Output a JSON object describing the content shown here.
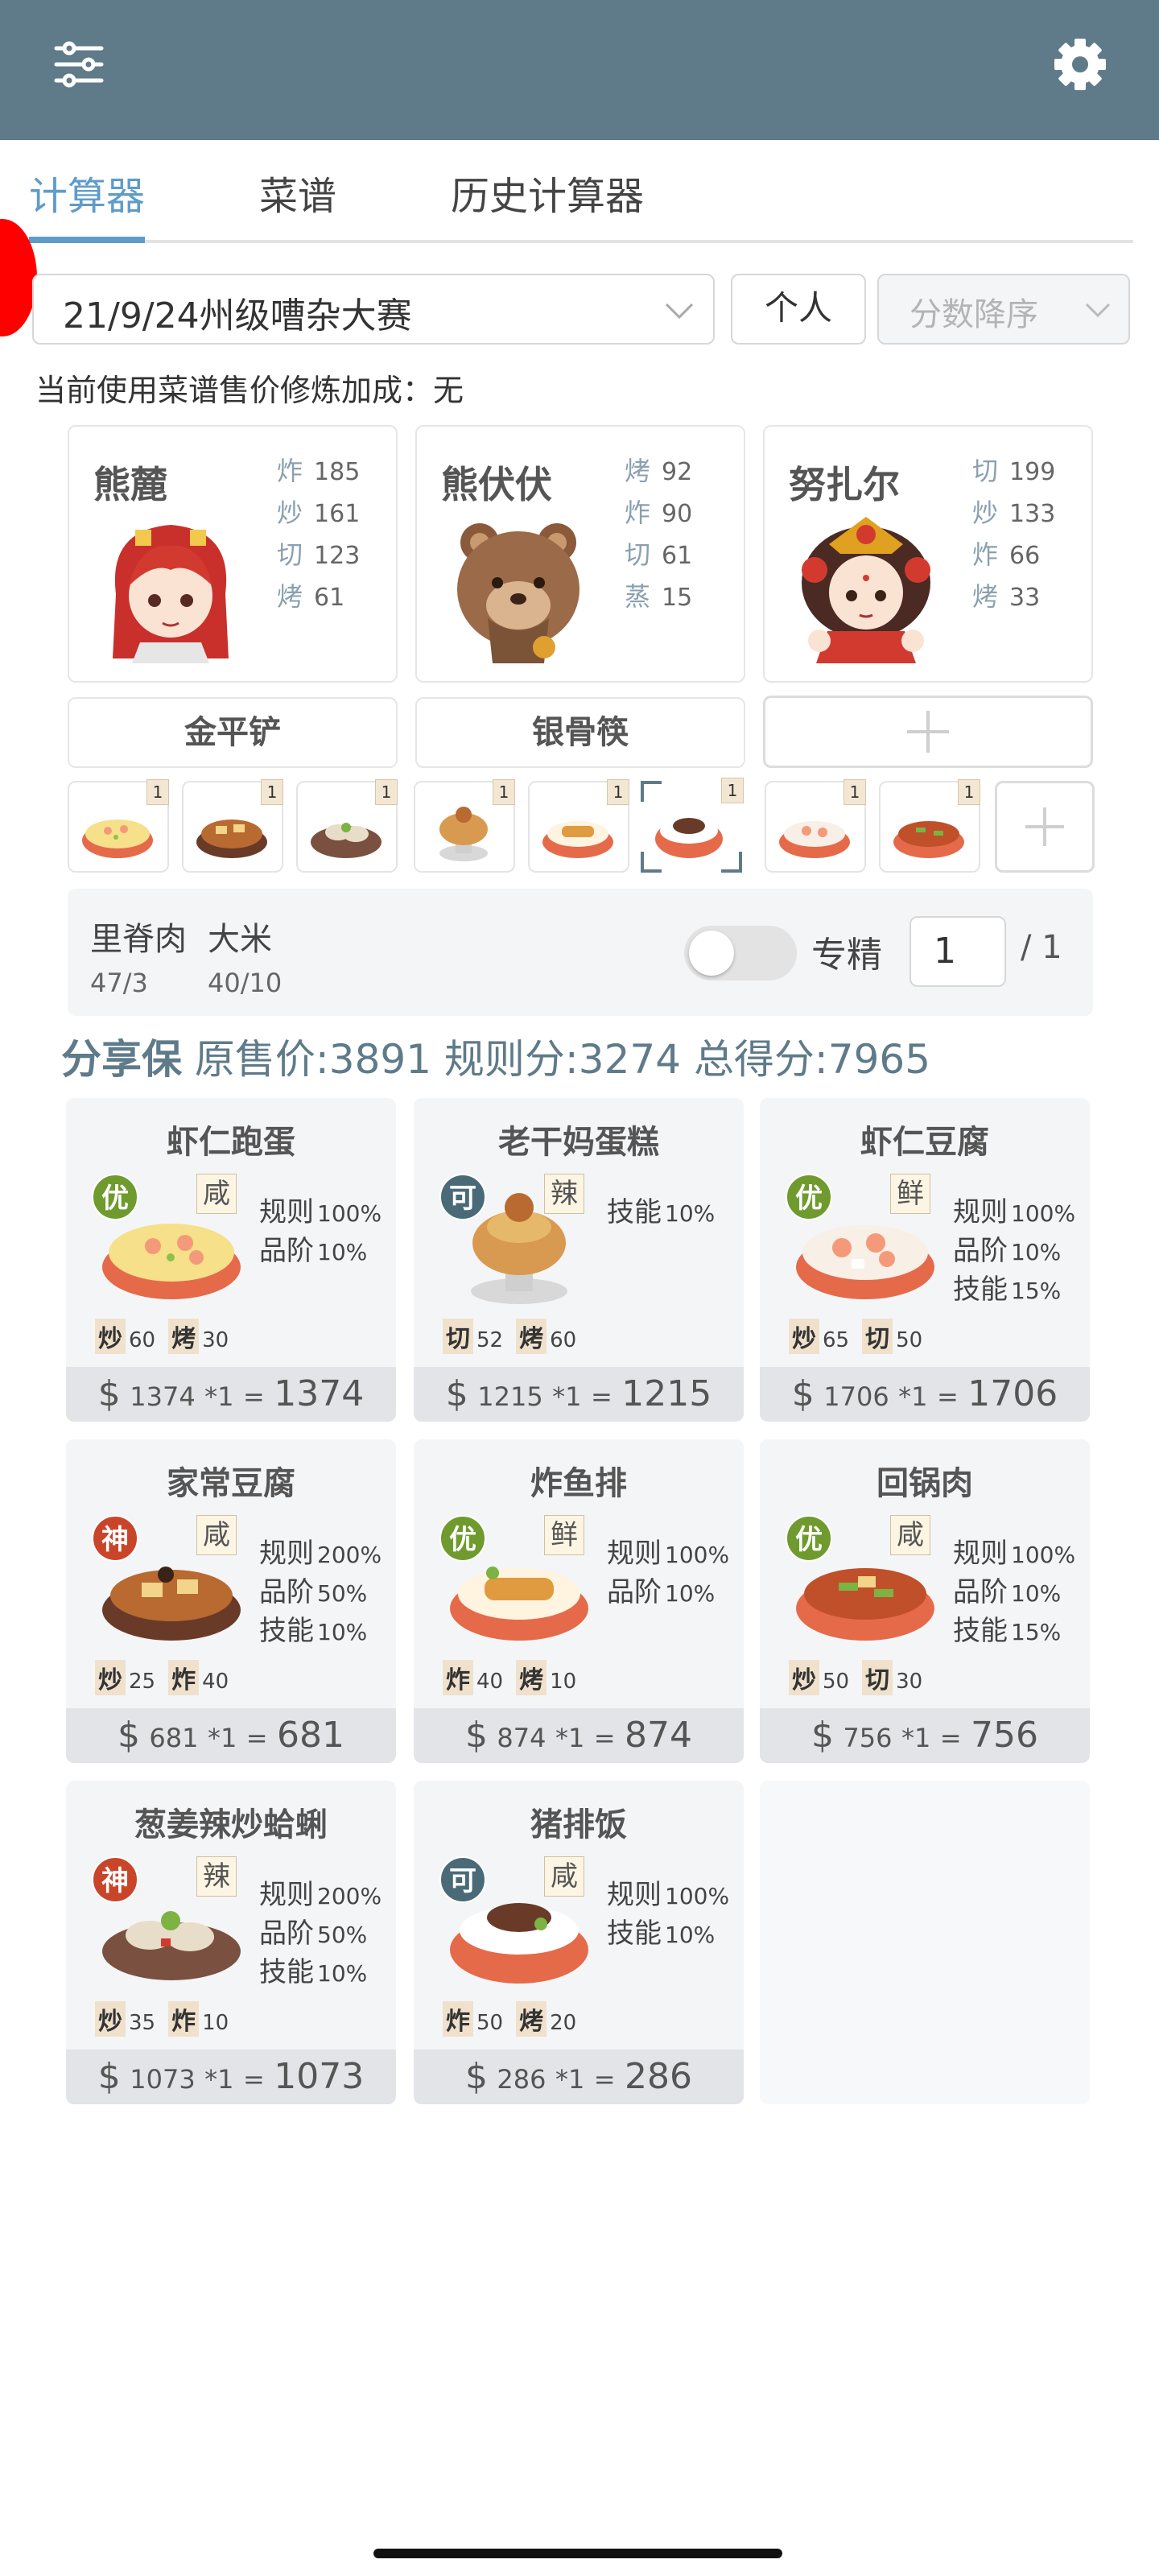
{
  "tabs": [
    "计算器",
    "菜谱",
    "历史计算器"
  ],
  "contest_select": "21/9/24州级嘈杂大赛",
  "mode_button": "个人",
  "sort_select": "分数降序",
  "bonus_note": "当前使用菜谱售价修炼加成：无",
  "chefs": [
    {
      "name": "熊麓",
      "skills": [
        {
          "k": "炸",
          "v": "185"
        },
        {
          "k": "炒",
          "v": "161"
        },
        {
          "k": "切",
          "v": "123"
        },
        {
          "k": "烤",
          "v": "61"
        }
      ]
    },
    {
      "name": "熊伏伏",
      "skills": [
        {
          "k": "烤",
          "v": "92"
        },
        {
          "k": "炸",
          "v": "90"
        },
        {
          "k": "切",
          "v": "61"
        },
        {
          "k": "蒸",
          "v": "15"
        }
      ]
    },
    {
      "name": "努扎尔",
      "skills": [
        {
          "k": "切",
          "v": "199"
        },
        {
          "k": "炒",
          "v": "133"
        },
        {
          "k": "炸",
          "v": "66"
        },
        {
          "k": "烤",
          "v": "33"
        }
      ]
    }
  ],
  "equipment": [
    "金平铲",
    "银骨筷"
  ],
  "dish_slots": [
    {
      "qty": "1",
      "selected": false
    },
    {
      "qty": "1",
      "selected": false
    },
    {
      "qty": "1",
      "selected": false
    },
    {
      "qty": "1",
      "selected": false
    },
    {
      "qty": "1",
      "selected": false
    },
    {
      "qty": "1",
      "selected": true
    },
    {
      "qty": "1",
      "selected": false
    },
    {
      "qty": "1",
      "selected": false
    }
  ],
  "ingredients": [
    {
      "name": "里脊肉",
      "count": "47/3"
    },
    {
      "name": "大米",
      "count": "40/10"
    }
  ],
  "specialty_label": "专精",
  "specialty_value": "1",
  "specialty_max": "/ 1",
  "summary": {
    "share_label": "分享保",
    "original_label": "原售价:",
    "original_value": "3891",
    "rule_label": "规则分:",
    "rule_value": "3274",
    "total_label": "总得分:",
    "total_value": "7965"
  },
  "recipes": [
    {
      "name": "虾仁跑蛋",
      "rank": "优",
      "rank_color": "#6f9a2e",
      "flavor": "咸",
      "bonus": [
        {
          "label": "规则",
          "pct": "100%"
        },
        {
          "label": "品阶",
          "pct": "10%"
        }
      ],
      "reqs": [
        {
          "k": "炒",
          "v": "60"
        },
        {
          "k": "烤",
          "v": "30"
        }
      ],
      "price": "1374",
      "mult": "*1",
      "total": "1374"
    },
    {
      "name": "老干妈蛋糕",
      "rank": "可",
      "rank_color": "#4a6a78",
      "flavor": "辣",
      "bonus": [
        {
          "label": "技能",
          "pct": "10%"
        }
      ],
      "reqs": [
        {
          "k": "切",
          "v": "52"
        },
        {
          "k": "烤",
          "v": "60"
        }
      ],
      "price": "1215",
      "mult": "*1",
      "total": "1215"
    },
    {
      "name": "虾仁豆腐",
      "rank": "优",
      "rank_color": "#6f9a2e",
      "flavor": "鲜",
      "bonus": [
        {
          "label": "规则",
          "pct": "100%"
        },
        {
          "label": "品阶",
          "pct": "10%"
        },
        {
          "label": "技能",
          "pct": "15%"
        }
      ],
      "reqs": [
        {
          "k": "炒",
          "v": "65"
        },
        {
          "k": "切",
          "v": "50"
        }
      ],
      "price": "1706",
      "mult": "*1",
      "total": "1706"
    },
    {
      "name": "家常豆腐",
      "rank": "神",
      "rank_color": "#c9452a",
      "flavor": "咸",
      "bonus": [
        {
          "label": "规则",
          "pct": "200%"
        },
        {
          "label": "品阶",
          "pct": "50%"
        },
        {
          "label": "技能",
          "pct": "10%"
        }
      ],
      "reqs": [
        {
          "k": "炒",
          "v": "25"
        },
        {
          "k": "炸",
          "v": "40"
        }
      ],
      "price": "681",
      "mult": "*1",
      "total": "681"
    },
    {
      "name": "炸鱼排",
      "rank": "优",
      "rank_color": "#6f9a2e",
      "flavor": "鲜",
      "bonus": [
        {
          "label": "规则",
          "pct": "100%"
        },
        {
          "label": "品阶",
          "pct": "10%"
        }
      ],
      "reqs": [
        {
          "k": "炸",
          "v": "40"
        },
        {
          "k": "烤",
          "v": "10"
        }
      ],
      "price": "874",
      "mult": "*1",
      "total": "874"
    },
    {
      "name": "回锅肉",
      "rank": "优",
      "rank_color": "#6f9a2e",
      "flavor": "咸",
      "bonus": [
        {
          "label": "规则",
          "pct": "100%"
        },
        {
          "label": "品阶",
          "pct": "10%"
        },
        {
          "label": "技能",
          "pct": "15%"
        }
      ],
      "reqs": [
        {
          "k": "炒",
          "v": "50"
        },
        {
          "k": "切",
          "v": "30"
        }
      ],
      "price": "756",
      "mult": "*1",
      "total": "756"
    },
    {
      "name": "葱姜辣炒蛤蜊",
      "rank": "神",
      "rank_color": "#c9452a",
      "flavor": "辣",
      "bonus": [
        {
          "label": "规则",
          "pct": "200%"
        },
        {
          "label": "品阶",
          "pct": "50%"
        },
        {
          "label": "技能",
          "pct": "10%"
        }
      ],
      "reqs": [
        {
          "k": "炒",
          "v": "35"
        },
        {
          "k": "炸",
          "v": "10"
        }
      ],
      "price": "1073",
      "mult": "*1",
      "total": "1073"
    },
    {
      "name": "猪排饭",
      "rank": "可",
      "rank_color": "#4a6a78",
      "flavor": "咸",
      "bonus": [
        {
          "label": "规则",
          "pct": "100%"
        },
        {
          "label": "技能",
          "pct": "10%"
        }
      ],
      "reqs": [
        {
          "k": "炸",
          "v": "50"
        },
        {
          "k": "烤",
          "v": "20"
        }
      ],
      "price": "286",
      "mult": "*1",
      "total": "286"
    }
  ],
  "colors": {
    "header": "#5f7b8a",
    "accent": "#5f9bc9",
    "panel": "#f4f5f7"
  }
}
